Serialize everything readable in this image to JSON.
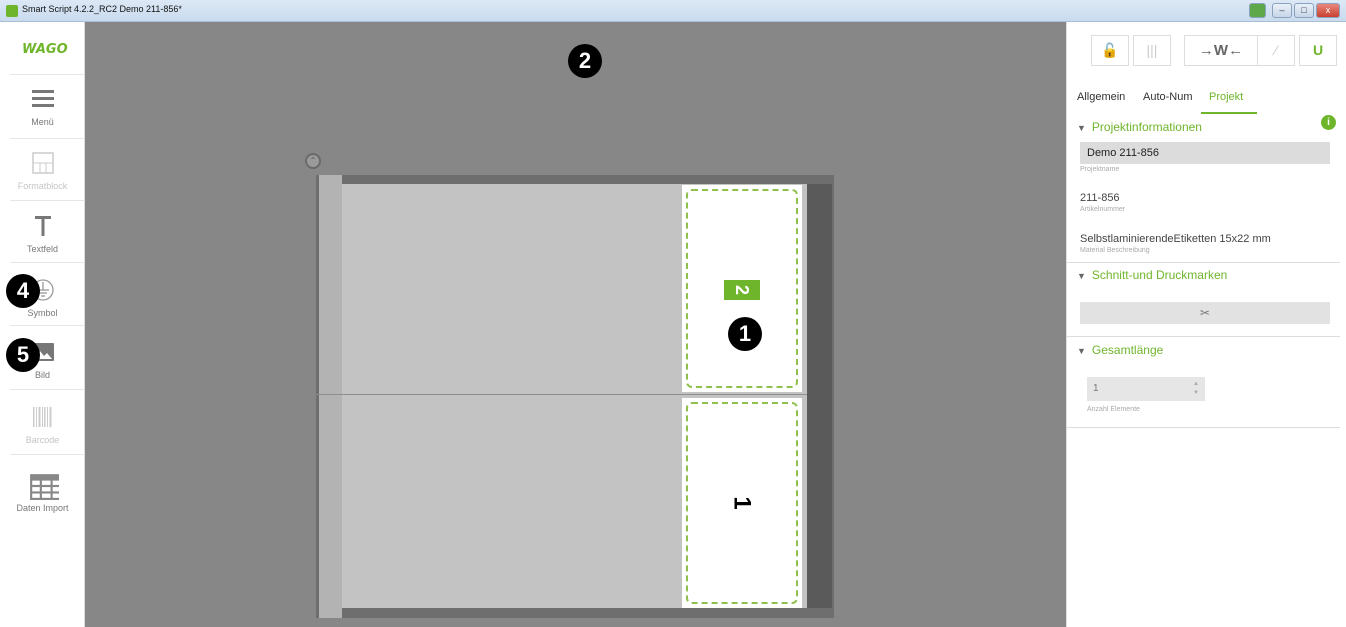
{
  "window": {
    "title": "Smart Script 4.2.2_RC2  Demo 211-856*",
    "controls": {
      "minimize": "–",
      "maximize": "□",
      "close": "x"
    }
  },
  "left_toolbar": {
    "logo": "WAGO",
    "items": [
      {
        "label": "Menü",
        "icon": "hamburger-icon",
        "enabled": true
      },
      {
        "label": "Formatblock",
        "icon": "formatblock-icon",
        "enabled": false
      },
      {
        "label": "Textfeld",
        "icon": "text-t-icon",
        "enabled": true
      },
      {
        "label": "Symbol",
        "icon": "ground-symbol-icon",
        "enabled": true
      },
      {
        "label": "Bild",
        "icon": "image-icon",
        "enabled": true
      },
      {
        "label": "Barcode",
        "icon": "barcode-icon",
        "enabled": false
      },
      {
        "label": "Daten Import",
        "icon": "table-import-icon",
        "enabled": true
      }
    ]
  },
  "canvas": {
    "labels": [
      {
        "text": "2",
        "selected": true
      },
      {
        "text": "1",
        "selected": false
      }
    ],
    "callouts": [
      "1",
      "2",
      "4",
      "5"
    ],
    "collapse_icon": "chevron-up-icon"
  },
  "right_panel": {
    "toolbar": [
      {
        "icon": "unlock-icon",
        "glyph": "🔓",
        "enabled": true
      },
      {
        "icon": "columns-icon",
        "glyph": "|||",
        "enabled": false
      },
      {
        "icon": "fit-width-icon",
        "glyph": "→W←",
        "enabled": true
      },
      {
        "icon": "magic-wand-icon",
        "glyph": "⁄",
        "enabled": false
      },
      {
        "icon": "magnet-icon",
        "glyph": "U",
        "enabled": true,
        "active": true
      }
    ],
    "tabs": [
      "Allgemein",
      "Auto-Num",
      "Projekt"
    ],
    "active_tab": "Projekt",
    "sections": {
      "projekt": {
        "title": "Projektinformationen",
        "info_icon": "i",
        "fields": [
          {
            "value": "Demo 211-856",
            "caption": "Projektname"
          },
          {
            "value": "211-856",
            "caption": "Artikelnummer"
          },
          {
            "value": "SelbstlaminierendeEtiketten 15x22 mm",
            "caption": "Material Beschreibung"
          }
        ]
      },
      "marken": {
        "title": "Schnitt-und Druckmarken",
        "button_icon": "scissors-icon",
        "button_glyph": "✂"
      },
      "laenge": {
        "title": "Gesamtlänge",
        "value": "1",
        "caption": "Anzahl Elemente"
      }
    }
  },
  "colors": {
    "accent": "#6fb52c",
    "canvas_bg": "#878787",
    "sheet_bg": "#c3c3c3"
  }
}
